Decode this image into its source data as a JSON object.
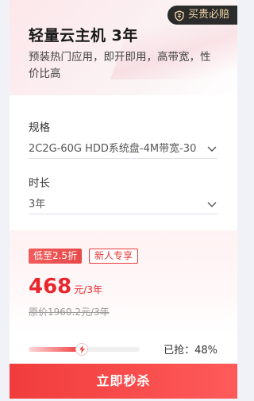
{
  "badge": {
    "text": "买贵必赔",
    "icon": "shield-icon"
  },
  "product": {
    "title": "轻量云主机 3年",
    "description": "预装热门应用，即开即用，高带宽，性价比高"
  },
  "spec": {
    "label": "规格",
    "value": "2C2G-60G HDD系统盘-4M带宽-30"
  },
  "duration": {
    "label": "时长",
    "value": "3年"
  },
  "tags": {
    "discount": "低至2.5折",
    "new_user": "新人专享"
  },
  "price": {
    "amount": "468",
    "unit": "元/3年",
    "original": "原价1960.2元/3年"
  },
  "progress": {
    "percent": 48,
    "label": "已抢：48%"
  },
  "cta": {
    "label": "立即秒杀"
  },
  "colors": {
    "accent": "#e8262c",
    "badge_bg": "#2b2b2b",
    "badge_text": "#f3d9a8"
  }
}
